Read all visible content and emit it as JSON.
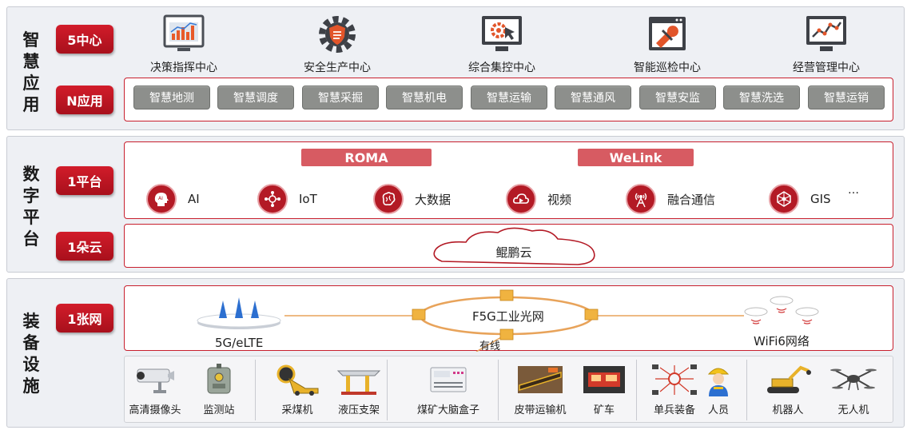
{
  "layers": [
    {
      "title": "智慧应用"
    },
    {
      "title": "数字平台"
    },
    {
      "title": "装备设施"
    }
  ],
  "pills": {
    "centers": "5中心",
    "apps": "N应用",
    "platform": "1平台",
    "cloud": "1朵云",
    "network": "1张网"
  },
  "centers": [
    {
      "label": "决策指挥中心",
      "icon": "chart-monitor-icon"
    },
    {
      "label": "安全生产中心",
      "icon": "gear-shield-icon"
    },
    {
      "label": "综合集控中心",
      "icon": "control-monitor-icon"
    },
    {
      "label": "智能巡检中心",
      "icon": "wrench-window-icon"
    },
    {
      "label": "经营管理中心",
      "icon": "trend-monitor-icon"
    }
  ],
  "apps": [
    "智慧地测",
    "智慧调度",
    "智慧采掘",
    "智慧机电",
    "智慧运输",
    "智慧通风",
    "智慧安监",
    "智慧洗选",
    "智慧运销"
  ],
  "platform": {
    "bars": [
      "ROMA",
      "WeLink"
    ],
    "capabilities": [
      {
        "label": "AI",
        "icon": "ai-head-icon"
      },
      {
        "label": "IoT",
        "icon": "iot-network-icon"
      },
      {
        "label": "大数据",
        "icon": "brain-data-icon"
      },
      {
        "label": "视频",
        "icon": "video-cloud-icon"
      },
      {
        "label": "融合通信",
        "icon": "antenna-icon"
      },
      {
        "label": "GIS",
        "icon": "gis-globe-icon"
      },
      {
        "label": "…",
        "icon": ""
      }
    ],
    "cloud_label": "鲲鹏云"
  },
  "network": {
    "left": "5G/eLTE",
    "center": "F5G工业光网",
    "wired": "有线",
    "right": "WiFi6网络"
  },
  "devices": [
    {
      "label": "高清摄像头",
      "icon": "camera-icon"
    },
    {
      "label": "监测站",
      "icon": "monitor-station-icon"
    },
    {
      "label": "采煤机",
      "icon": "shearer-icon"
    },
    {
      "label": "液压支架",
      "icon": "hydraulic-support-icon"
    },
    {
      "label": "煤矿大脑盒子",
      "icon": "brain-box-icon"
    },
    {
      "label": "皮带运输机",
      "icon": "belt-conveyor-icon"
    },
    {
      "label": "矿车",
      "icon": "mine-car-icon"
    },
    {
      "label": "单兵装备",
      "icon": "soldier-gear-icon"
    },
    {
      "label": "人员",
      "icon": "worker-icon"
    },
    {
      "label": "机器人",
      "icon": "robot-icon"
    },
    {
      "label": "无人机",
      "icon": "drone-icon"
    }
  ]
}
